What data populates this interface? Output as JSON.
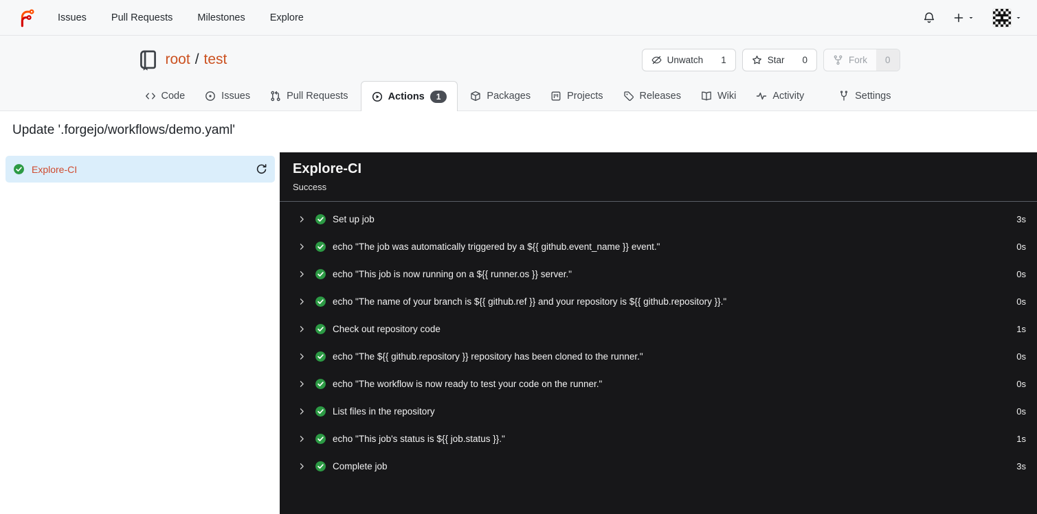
{
  "navbar": {
    "items": [
      {
        "label": "Issues"
      },
      {
        "label": "Pull Requests"
      },
      {
        "label": "Milestones"
      },
      {
        "label": "Explore"
      }
    ]
  },
  "repo": {
    "owner": "root",
    "separator": "/",
    "name": "test",
    "actions": {
      "unwatch": {
        "label": "Unwatch",
        "count": "1"
      },
      "star": {
        "label": "Star",
        "count": "0"
      },
      "fork": {
        "label": "Fork",
        "count": "0"
      }
    }
  },
  "tabs": [
    {
      "label": "Code",
      "icon": "code-icon"
    },
    {
      "label": "Issues",
      "icon": "issue-icon"
    },
    {
      "label": "Pull Requests",
      "icon": "pull-request-icon"
    },
    {
      "label": "Actions",
      "icon": "actions-icon",
      "badge": "1",
      "active": true
    },
    {
      "label": "Packages",
      "icon": "package-icon"
    },
    {
      "label": "Projects",
      "icon": "project-icon"
    },
    {
      "label": "Releases",
      "icon": "tag-icon"
    },
    {
      "label": "Wiki",
      "icon": "wiki-icon"
    },
    {
      "label": "Activity",
      "icon": "activity-icon"
    },
    {
      "label": "Settings",
      "icon": "settings-icon",
      "align_right": true
    }
  ],
  "run": {
    "title": "Update '.forgejo/workflows/demo.yaml'",
    "job": {
      "name": "Explore-CI",
      "status": "Success"
    }
  },
  "panel": {
    "title": "Explore-CI",
    "status": "Success"
  },
  "steps": [
    {
      "label": "Set up job",
      "duration": "3s"
    },
    {
      "label": "echo \"The job was automatically triggered by a ${{ github.event_name }} event.\"",
      "duration": "0s"
    },
    {
      "label": "echo \"This job is now running on a ${{ runner.os }} server.\"",
      "duration": "0s"
    },
    {
      "label": "echo \"The name of your branch is ${{ github.ref }} and your repository is ${{ github.repository }}.\"",
      "duration": "0s"
    },
    {
      "label": "Check out repository code",
      "duration": "1s"
    },
    {
      "label": "echo \"The ${{ github.repository }} repository has been cloned to the runner.\"",
      "duration": "0s"
    },
    {
      "label": "echo \"The workflow is now ready to test your code on the runner.\"",
      "duration": "0s"
    },
    {
      "label": "List files in the repository",
      "duration": "0s"
    },
    {
      "label": "echo \"This job's status is ${{ job.status }}.\"",
      "duration": "1s"
    },
    {
      "label": "Complete job",
      "duration": "3s"
    }
  ],
  "colors": {
    "repo_link": "#cb5120",
    "job_link": "#cf4a2e",
    "success_green": "#2c9a44",
    "selected_bg": "#dbeefb",
    "panel_bg": "#171719",
    "badge_bg": "#4a4e55"
  }
}
